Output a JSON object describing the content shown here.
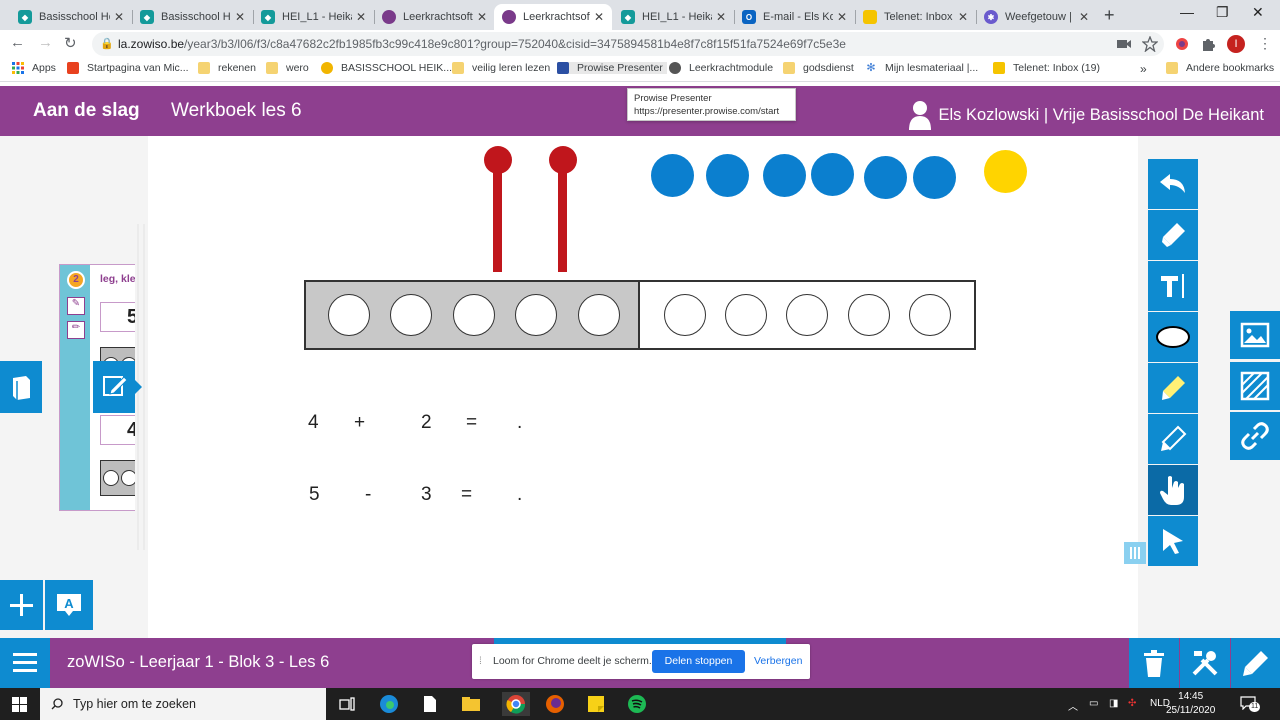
{
  "browser": {
    "tabs": [
      {
        "title": "Basisschool He",
        "favicon": "teal"
      },
      {
        "title": "Basisschool He",
        "favicon": "teal"
      },
      {
        "title": "HEI_L1 - Heikan",
        "favicon": "teal"
      },
      {
        "title": "Leerkrachtsoftw",
        "favicon": "purple"
      },
      {
        "title": "Leerkrachtsoftw",
        "favicon": "purple",
        "active": true
      },
      {
        "title": "HEI_L1 - Heikan",
        "favicon": "teal"
      },
      {
        "title": "E-mail - Els Koz",
        "favicon": "outlook"
      },
      {
        "title": "Telenet: Inbox",
        "favicon": "yellow"
      },
      {
        "title": "Weefgetouw |",
        "favicon": "gear"
      }
    ],
    "url_host": "la.zowiso.be",
    "url_rest": "/year3/b3/l06/f3/c8a47682c2fb1985fb3c99c418e9c801?group=752040&cisid=3475894581b4e8f7c8f15f51fa7524e69f7c5e3e",
    "profile_initial": "I",
    "bookmarks": [
      "Apps",
      "Startpagina van Mic...",
      "rekenen",
      "wero",
      "BASISSCHOOL HEIK...",
      "veilig leren lezen",
      "Prowise Presenter",
      "Leerkrachtmodule",
      "godsdienst",
      "Mijn lesmateriaal |...",
      "Telenet: Inbox (19)"
    ],
    "bookmarks_overflow": "»",
    "other_bookmarks": "Andere bookmarks",
    "tooltip": {
      "title": "Prowise Presenter",
      "url": "https://presenter.prowise.com/start"
    }
  },
  "app": {
    "header": {
      "start": "Aan de slag",
      "book": "Werkboek les 6",
      "user": "Els Kozlowski | Vrije Basisschool De Heikant"
    },
    "mini_card": {
      "badge": "2",
      "label": "leg, kle",
      "box1": "5",
      "box2": "4"
    },
    "board": {
      "sticks": 2,
      "blue_dots": 6,
      "yellow_dots": 1,
      "frame_cells": 10,
      "frame_grey_cells": 5
    },
    "equations": [
      {
        "a": "4",
        "op": "+",
        "b": "2",
        "eq": "=",
        "ans": "."
      },
      {
        "a": "5",
        "op": "-",
        "b": "3",
        "eq": "=",
        "ans": "."
      }
    ],
    "footer": {
      "course": "zoWISo - Leerjaar 1 - Blok 3 - Les 6"
    }
  },
  "loom": {
    "message": "Loom for Chrome deelt je scherm.",
    "stop": "Delen stoppen",
    "hide": "Verbergen"
  },
  "taskbar": {
    "search_placeholder": "Typ hier om te zoeken",
    "lang": "NLD",
    "time": "14:45",
    "date": "25/11/2020",
    "notifications": "11"
  },
  "colors": {
    "purple": "#8e3f8f",
    "blue": "#0e8bd0",
    "red": "#c0161c",
    "yellow": "#ffd400"
  }
}
